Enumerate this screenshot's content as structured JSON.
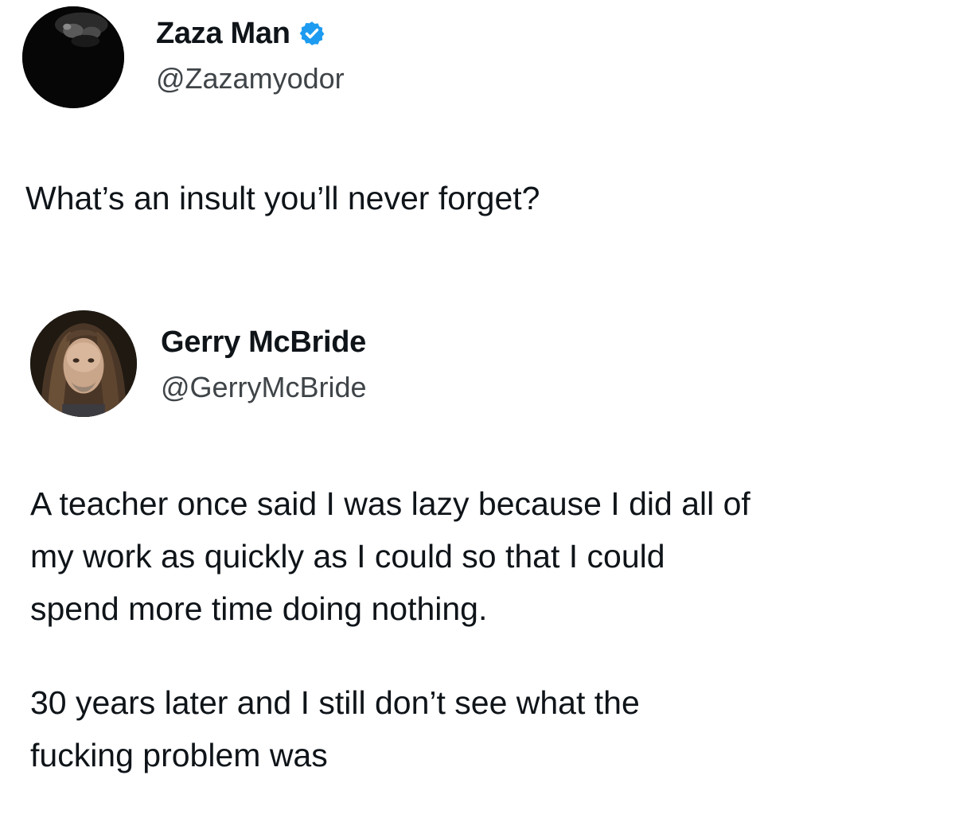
{
  "tweets": [
    {
      "author": {
        "display_name": "Zaza Man",
        "handle": "@Zazamyodor",
        "verified": true,
        "avatar_icon": "dark-profile-photo"
      },
      "paragraphs": [
        "What’s an insult you’ll never forget?"
      ]
    },
    {
      "author": {
        "display_name": "Gerry McBride",
        "handle": "@GerryMcBride",
        "verified": false,
        "avatar_icon": "long-haired-man-photo"
      },
      "paragraphs": [
        "A teacher once said I was lazy because I did all of\nmy work as quickly as I could so that I could\nspend more time doing nothing.",
        "30 years later and I still don’t see what the\nfucking problem was"
      ]
    }
  ],
  "colors": {
    "verified_badge": "#1d9bf0",
    "text_primary": "#0f1419",
    "text_secondary": "#3f4448",
    "background": "#ffffff"
  }
}
